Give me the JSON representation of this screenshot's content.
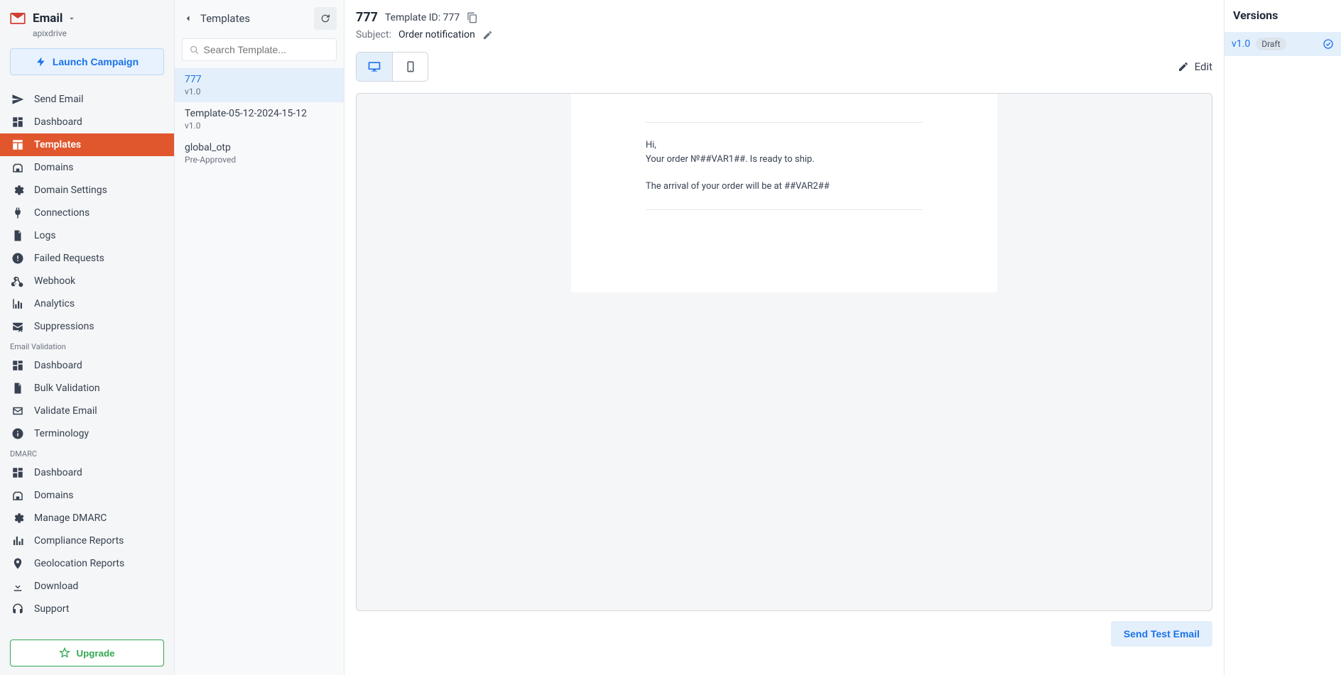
{
  "sidebar": {
    "brand": "Email",
    "account": "apixdrive",
    "launch_label": "Launch Campaign",
    "upgrade_label": "Upgrade",
    "groups": [
      {
        "label": "",
        "items": [
          {
            "id": "send-email",
            "label": "Send Email",
            "icon": "send-icon"
          },
          {
            "id": "dashboard",
            "label": "Dashboard",
            "icon": "dashboard-icon"
          },
          {
            "id": "templates",
            "label": "Templates",
            "icon": "templates-icon",
            "active": true
          },
          {
            "id": "domains",
            "label": "Domains",
            "icon": "domains-icon"
          },
          {
            "id": "domain-settings",
            "label": "Domain Settings",
            "icon": "gear-icon"
          },
          {
            "id": "connections",
            "label": "Connections",
            "icon": "plug-icon"
          },
          {
            "id": "logs",
            "label": "Logs",
            "icon": "file-icon"
          },
          {
            "id": "failed-requests",
            "label": "Failed Requests",
            "icon": "error-icon"
          },
          {
            "id": "webhook",
            "label": "Webhook",
            "icon": "webhook-icon"
          },
          {
            "id": "analytics",
            "label": "Analytics",
            "icon": "analytics-icon"
          },
          {
            "id": "suppressions",
            "label": "Suppressions",
            "icon": "suppress-icon"
          }
        ]
      },
      {
        "label": "Email Validation",
        "items": [
          {
            "id": "ev-dashboard",
            "label": "Dashboard",
            "icon": "dashboard-icon"
          },
          {
            "id": "bulk-validation",
            "label": "Bulk Validation",
            "icon": "file-icon"
          },
          {
            "id": "validate-email",
            "label": "Validate Email",
            "icon": "mail-icon"
          },
          {
            "id": "terminology",
            "label": "Terminology",
            "icon": "info-icon"
          }
        ]
      },
      {
        "label": "DMARC",
        "items": [
          {
            "id": "dm-dashboard",
            "label": "Dashboard",
            "icon": "dashboard-icon"
          },
          {
            "id": "dm-domains",
            "label": "Domains",
            "icon": "domains-icon"
          },
          {
            "id": "manage-dmarc",
            "label": "Manage DMARC",
            "icon": "gear-icon"
          },
          {
            "id": "compliance",
            "label": "Compliance Reports",
            "icon": "bar-icon"
          },
          {
            "id": "geolocation",
            "label": "Geolocation Reports",
            "icon": "pin-icon"
          },
          {
            "id": "download",
            "label": "Download",
            "icon": "download-icon"
          },
          {
            "id": "support",
            "label": "Support",
            "icon": "headset-icon"
          }
        ]
      }
    ]
  },
  "list": {
    "title": "Templates",
    "search_placeholder": "Search Template...",
    "items": [
      {
        "name": "777",
        "sub": "v1.0",
        "selected": true
      },
      {
        "name": "Template-05-12-2024-15-12",
        "sub": "v1.0"
      },
      {
        "name": "global_otp",
        "sub": "Pre-Approved"
      }
    ]
  },
  "main": {
    "template_name": "777",
    "id_label": "Template ID: 777",
    "subject_label": "Subject:",
    "subject": "Order notification",
    "edit_label": "Edit",
    "send_test_label": "Send Test Email",
    "email_body": {
      "p1": "Hi,",
      "p2": "Your order №##VAR1##. Is ready to ship.",
      "p3": "The arrival of your order will be at ##VAR2##"
    }
  },
  "versions": {
    "title": "Versions",
    "items": [
      {
        "label": "v1.0",
        "badge": "Draft"
      }
    ]
  }
}
